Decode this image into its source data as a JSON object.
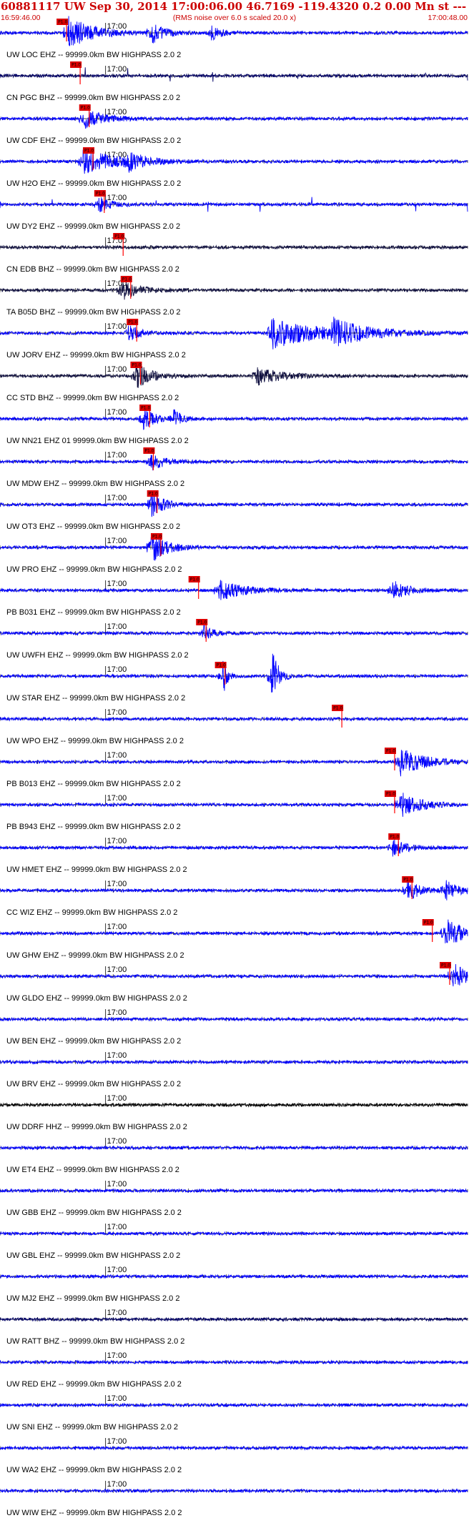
{
  "header": {
    "title": "60881117 UW Sep 30, 2014 17:00:06.00   46.7169 -119.4320  0.2 0.00 Mn st --- -- --  -1",
    "time_start": "16:59:46.00",
    "time_end": "17:00:48.00",
    "note": "(RMS noise over 6.0 s scaled 20.0 x)"
  },
  "colors": {
    "text": "#cc0000",
    "trace": "#0000ff",
    "trace_dark": "#000066",
    "trace_navy": "#101040",
    "trace_black": "#000000",
    "axis": "#000000",
    "pick": "#ff0000",
    "pick_box": "#dd0000"
  },
  "chart_data": {
    "type": "line",
    "xlabel": "",
    "ylabel": "",
    "x_range_seconds": [
      0,
      62
    ],
    "minute_mark_label": "17:00",
    "minute_mark_seconds": 14,
    "tick_interval_seconds": 1,
    "pick_label": "P1.0",
    "series": [
      {
        "label": "UW LOC EHZ -- 99999.0km BW  HIGHPASS  2.0  2",
        "color": "trace",
        "pick": 7.5,
        "bursts": [
          [
            9,
            3,
            2.6
          ],
          [
            20,
            1.5,
            1.8
          ],
          [
            28,
            1.2,
            1.2
          ]
        ]
      },
      {
        "label": "CN PGC BHZ -- 99999.0km BW  HIGHPASS  2.0  2",
        "color": "trace_dark",
        "pick": 9.3,
        "spikes": 11,
        "bursts": []
      },
      {
        "label": "UW CDF EHZ -- 99999.0km BW  HIGHPASS  2.0  2",
        "color": "trace",
        "pick": 10.5,
        "bursts": [
          [
            11,
            2.5,
            1.6
          ]
        ]
      },
      {
        "label": "UW H2O EHZ -- 99999.0km BW  HIGHPASS  2.0  2",
        "color": "trace",
        "pick": 11,
        "bursts": [
          [
            11,
            4,
            2.0
          ],
          [
            17,
            2,
            1.2
          ]
        ]
      },
      {
        "label": "UW DY2 EHZ -- 99999.0km BW  HIGHPASS  2.0  2",
        "color": "trace",
        "pick": 12.5,
        "spikes": 9,
        "bursts": [
          [
            13,
            1.5,
            1.2
          ]
        ]
      },
      {
        "label": "CN EDB BHZ -- 99999.0km BW  HIGHPASS  2.0  2",
        "color": "trace_navy",
        "pick": 15,
        "bursts": []
      },
      {
        "label": "TA B05D BHZ -- 99999.0km BW  HIGHPASS  2.0  2",
        "color": "trace_navy",
        "pick": 16,
        "bursts": [
          [
            16,
            2,
            1.6
          ]
        ]
      },
      {
        "label": "UW JORV EHZ -- 99999.0km BW  HIGHPASS  2.0  2",
        "color": "trace",
        "pick": 16.8,
        "bursts": [
          [
            17,
            1.5,
            1.3
          ],
          [
            36,
            6,
            2.4
          ],
          [
            44,
            4,
            1.8
          ]
        ]
      },
      {
        "label": "CC STD BHZ -- 99999.0km BW  HIGHPASS  2.0  2",
        "color": "trace_navy",
        "pick": 17.3,
        "bursts": [
          [
            18,
            2,
            2.0
          ],
          [
            34,
            3,
            1.4
          ]
        ]
      },
      {
        "label": "UW NN21 EHZ 01 99999.0km BW  HIGHPASS  2.0  2",
        "color": "trace",
        "pick": 18.5,
        "bursts": [
          [
            19,
            1.5,
            1.6
          ],
          [
            23,
            1,
            1.3
          ]
        ]
      },
      {
        "label": "UW MDW EHZ -- 99999.0km BW  HIGHPASS  2.0  2",
        "color": "trace",
        "pick": 19,
        "bursts": [
          [
            20,
            1.5,
            1.6
          ]
        ]
      },
      {
        "label": "UW OT3 EHZ -- 99999.0km BW  HIGHPASS  2.0  2",
        "color": "trace",
        "pick": 19.5,
        "bursts": [
          [
            20,
            1.5,
            2.2
          ]
        ]
      },
      {
        "label": "UW PRO EHZ -- 99999.0km BW  HIGHPASS  2.0  2",
        "color": "trace",
        "pick": 20,
        "bursts": [
          [
            20,
            2,
            2.4
          ]
        ]
      },
      {
        "label": "PB B031 EHZ -- 99999.0km BW  HIGHPASS  2.0  2",
        "color": "trace",
        "pick": 25,
        "bursts": [
          [
            29,
            3,
            1.6
          ],
          [
            52,
            2,
            1.5
          ]
        ]
      },
      {
        "label": "UW UWFH EHZ -- 99999.0km BW  HIGHPASS  2.0  2",
        "color": "trace",
        "pick": 26,
        "bursts": [
          [
            27,
            1,
            1.6
          ]
        ]
      },
      {
        "label": "UW STAR EHZ -- 99999.0km BW  HIGHPASS  2.0  2",
        "color": "trace",
        "pick": 28.5,
        "bursts": [
          [
            29.5,
            0.5,
            3.5
          ],
          [
            36,
            0.8,
            4.5
          ]
        ]
      },
      {
        "label": "UW WPO EHZ -- 99999.0km BW  HIGHPASS  2.0  2",
        "color": "trace",
        "pick": 44,
        "bursts": []
      },
      {
        "label": "PB B013 EHZ -- 99999.0km BW  HIGHPASS  2.0  2",
        "color": "trace",
        "pick": 51,
        "bursts": [
          [
            53,
            3,
            2.2
          ]
        ]
      },
      {
        "label": "PB B943 EHZ -- 99999.0km BW  HIGHPASS  2.0  2",
        "color": "trace",
        "pick": 51,
        "bursts": [
          [
            53,
            2.5,
            2.0
          ]
        ]
      },
      {
        "label": "UW HMET EHZ -- 99999.0km BW  HIGHPASS  2.0  2",
        "color": "trace",
        "pick": 51.5,
        "bursts": [
          [
            52,
            2,
            1.2
          ]
        ]
      },
      {
        "label": "CC WIZ EHZ -- 99999.0km BW  HIGHPASS  2.0  2",
        "color": "trace",
        "pick": 53.3,
        "bursts": [
          [
            54,
            1.5,
            1.8
          ],
          [
            59,
            1.5,
            1.6
          ]
        ]
      },
      {
        "label": "UW GHW EHZ -- 99999.0km BW  HIGHPASS  2.0  2",
        "color": "trace",
        "pick": 56,
        "bursts": [
          [
            59,
            2.5,
            2.4
          ]
        ]
      },
      {
        "label": "UW GLDO EHZ -- 99999.0km BW  HIGHPASS  2.0  2",
        "color": "trace",
        "pick": 58.3,
        "bursts": [
          [
            60,
            2,
            2.2
          ]
        ]
      },
      {
        "label": "UW BEN EHZ -- 99999.0km BW  HIGHPASS  2.0  2",
        "color": "trace",
        "bursts": []
      },
      {
        "label": "UW BRV EHZ -- 99999.0km BW  HIGHPASS  2.0  2",
        "color": "trace",
        "bursts": []
      },
      {
        "label": "UW DDRF HHZ -- 99999.0km BW  HIGHPASS  2.0  2",
        "color": "trace_black",
        "bursts": []
      },
      {
        "label": "UW ET4 EHZ -- 99999.0km BW  HIGHPASS  2.0  2",
        "color": "trace",
        "bursts": []
      },
      {
        "label": "UW GBB EHZ -- 99999.0km BW  HIGHPASS  2.0  2",
        "color": "trace",
        "bursts": []
      },
      {
        "label": "UW GBL EHZ -- 99999.0km BW  HIGHPASS  2.0  2",
        "color": "trace",
        "bursts": []
      },
      {
        "label": "UW MJ2 EHZ -- 99999.0km BW  HIGHPASS  2.0  2",
        "color": "trace",
        "bursts": []
      },
      {
        "label": "UW RATT BHZ -- 99999.0km BW  HIGHPASS  2.0  2",
        "color": "trace_dark",
        "bursts": []
      },
      {
        "label": "UW RED EHZ -- 99999.0km BW  HIGHPASS  2.0  2",
        "color": "trace",
        "bursts": []
      },
      {
        "label": "UW SNI EHZ -- 99999.0km BW  HIGHPASS  2.0  2",
        "color": "trace",
        "bursts": []
      },
      {
        "label": "UW WA2 EHZ -- 99999.0km BW  HIGHPASS  2.0  2",
        "color": "trace",
        "bursts": []
      },
      {
        "label": "UW WIW EHZ -- 99999.0km BW  HIGHPASS  2.0  2",
        "color": "trace",
        "bursts": []
      }
    ]
  }
}
